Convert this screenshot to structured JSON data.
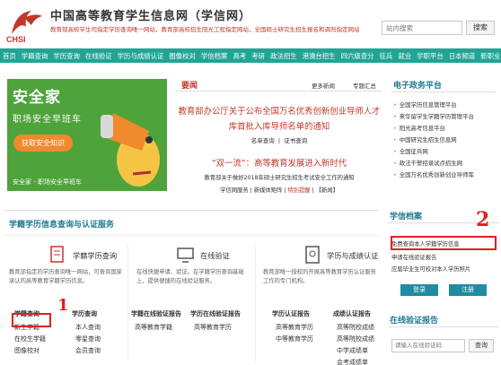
{
  "header": {
    "site_title": "中国高等教育学生信息网（学信网）",
    "logo_text": "CHSI",
    "tagline": "教育部高校学生司指定学历查询唯一网站，教育部高校招生阳光工程指定网站，全国硕士研究生招生报名和调剂指定网站",
    "search_placeholder": "站内搜索",
    "search_button": "搜索"
  },
  "nav": {
    "items": [
      "首页",
      "学籍查询",
      "学历查询",
      "在线验证",
      "学历与成绩认证",
      "图像校对",
      "学信档案",
      "高考",
      "考研",
      "政法招生",
      "港澳台招生",
      "四六级查分",
      "征兵",
      "就业",
      "学职平台",
      "日本频道",
      "新职业"
    ]
  },
  "banner": {
    "title": "安全家",
    "subtitle": "职场安全早班车",
    "badge": "获取安全知识",
    "caption": "安全家 - 职场安全早班车"
  },
  "news": {
    "heading": "要闻",
    "more": "更多新闻",
    "special": "专题汇总",
    "headline_line1": "教育部办公厅关于公布全国万名优秀创新创业导师人才",
    "headline_line2": "库首批入库导师名单的通知",
    "sub_link1": "名单查询",
    "sub_sep": "|",
    "sub_link2": "证书查询",
    "headline2": "“双一流”：高等教育发展进入新时代",
    "line3": "教育部关于做好2018年硕士研究生招生考试安全工作的通知",
    "line4_a": "学信网服务",
    "line4_b": "新媒体矩阵",
    "line4_c": "特别提醒",
    "line4_d": "【新闻】"
  },
  "egov": {
    "heading": "电子政务平台",
    "items": [
      "全国学历信息管理平台",
      "来华留学生学籍学历管理平台",
      "阳光高考信息平台",
      "中国研究生招生信息网",
      "全国征兵网",
      "政法干警招录试点招生网",
      "全国万名优秀创新创业导师库"
    ]
  },
  "service": {
    "title": "学籍学历信息查询与认证服务",
    "col1": {
      "name": "学籍学历查询",
      "desc": "教育部指定的学历查询唯一网站，可查询国家承认的高等教育学籍学历信息。",
      "sub1_title": "学籍查询",
      "sub1_links": [
        "新生学籍",
        "在校生学籍",
        "图像校对"
      ],
      "sub2_title": "学历查询",
      "sub2_links": [
        "本人查询",
        "零星查询",
        "会员查询"
      ]
    },
    "col2": {
      "name": "在线验证",
      "desc": "在线快捷申请、验证。在学籍学历查询基础上，提供便捷的在线验证服务。",
      "sub1_title": "学籍在线验证报告",
      "sub1_links": [
        "高等教育学籍"
      ],
      "sub2_title": "学历在线验证报告",
      "sub2_links": [
        "高等教育学历"
      ]
    },
    "col3": {
      "name": "学历与成绩认证",
      "desc": "教育部唯一授权的开展高等教育学历认证服务工作的专门机构。",
      "sub1_title": "学历认证报告",
      "sub1_links": [
        "高等教育学历",
        "中等教育学历"
      ],
      "sub2_title": "成绩认证报告",
      "sub2_links": [
        "高等院校成绩",
        "高等院校成绩",
        "中学成绩单",
        "会考成绩单"
      ]
    }
  },
  "dossier": {
    "heading": "学信档案",
    "line1": "免费查询本人学籍学历信息",
    "line2": "申请在线验证报告",
    "line3": "应届毕业生可校对本人学历照片",
    "login": "登录",
    "register": "注册"
  },
  "verify": {
    "heading": "在线验证报告",
    "placeholder": "请输入在线验证码",
    "button": "查询"
  },
  "annotations": {
    "mark1": "1",
    "mark2": "2"
  },
  "colors": {
    "nav_bg": "#22a495",
    "accent_red": "#c0392b",
    "panel_teal": "#1f7b8e",
    "annotation_red": "#e02020"
  }
}
